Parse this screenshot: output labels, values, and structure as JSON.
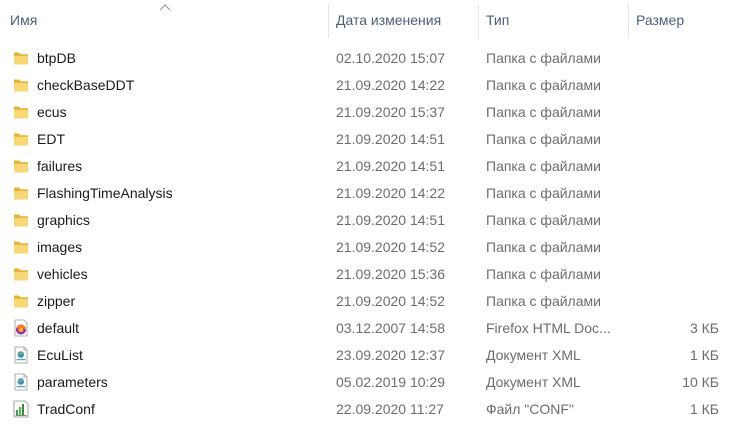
{
  "columns": {
    "name": "Имя",
    "date": "Дата изменения",
    "type": "Тип",
    "size": "Размер"
  },
  "files": [
    {
      "name": "btpDB",
      "date": "02.10.2020 15:07",
      "type": "Папка с файлами",
      "size": "",
      "icon": "folder-icon"
    },
    {
      "name": "checkBaseDDT",
      "date": "21.09.2020 14:22",
      "type": "Папка с файлами",
      "size": "",
      "icon": "folder-icon"
    },
    {
      "name": "ecus",
      "date": "21.09.2020 15:37",
      "type": "Папка с файлами",
      "size": "",
      "icon": "folder-icon"
    },
    {
      "name": "EDT",
      "date": "21.09.2020 14:51",
      "type": "Папка с файлами",
      "size": "",
      "icon": "folder-icon"
    },
    {
      "name": "failures",
      "date": "21.09.2020 14:51",
      "type": "Папка с файлами",
      "size": "",
      "icon": "folder-icon"
    },
    {
      "name": "FlashingTimeAnalysis",
      "date": "21.09.2020 14:22",
      "type": "Папка с файлами",
      "size": "",
      "icon": "folder-icon"
    },
    {
      "name": "graphics",
      "date": "21.09.2020 14:51",
      "type": "Папка с файлами",
      "size": "",
      "icon": "folder-icon"
    },
    {
      "name": "images",
      "date": "21.09.2020 14:52",
      "type": "Папка с файлами",
      "size": "",
      "icon": "folder-icon"
    },
    {
      "name": "vehicles",
      "date": "21.09.2020 15:36",
      "type": "Папка с файлами",
      "size": "",
      "icon": "folder-icon"
    },
    {
      "name": "zipper",
      "date": "21.09.2020 14:52",
      "type": "Папка с файлами",
      "size": "",
      "icon": "folder-icon"
    },
    {
      "name": "default",
      "date": "03.12.2007 14:58",
      "type": "Firefox HTML Doc...",
      "size": "3 КБ",
      "icon": "firefox-html-icon"
    },
    {
      "name": "EcuList",
      "date": "23.09.2020 12:37",
      "type": "Документ XML",
      "size": "1 КБ",
      "icon": "xml-document-icon"
    },
    {
      "name": "parameters",
      "date": "05.02.2019 10:29",
      "type": "Документ XML",
      "size": "10 КБ",
      "icon": "xml-document-icon"
    },
    {
      "name": "TradConf",
      "date": "22.09.2020 11:27",
      "type": "Файл \"CONF\"",
      "size": "1 КБ",
      "icon": "conf-file-icon"
    }
  ]
}
